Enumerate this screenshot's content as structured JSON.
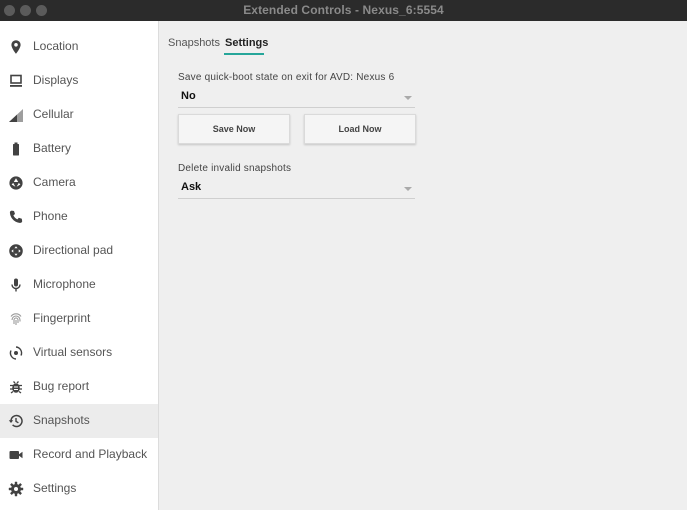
{
  "window": {
    "title": "Extended Controls - Nexus_6:5554"
  },
  "sidebar": {
    "items": [
      {
        "label": "Location",
        "icon": "location-pin-icon"
      },
      {
        "label": "Displays",
        "icon": "display-icon"
      },
      {
        "label": "Cellular",
        "icon": "cellular-signal-icon"
      },
      {
        "label": "Battery",
        "icon": "battery-icon"
      },
      {
        "label": "Camera",
        "icon": "camera-aperture-icon"
      },
      {
        "label": "Phone",
        "icon": "phone-icon"
      },
      {
        "label": "Directional pad",
        "icon": "dpad-icon"
      },
      {
        "label": "Microphone",
        "icon": "microphone-icon"
      },
      {
        "label": "Fingerprint",
        "icon": "fingerprint-icon"
      },
      {
        "label": "Virtual sensors",
        "icon": "rotate-sensor-icon"
      },
      {
        "label": "Bug report",
        "icon": "bug-icon"
      },
      {
        "label": "Snapshots",
        "icon": "history-clock-icon"
      },
      {
        "label": "Record and Playback",
        "icon": "video-camera-icon"
      },
      {
        "label": "Settings",
        "icon": "gear-icon"
      }
    ],
    "active": "Snapshots"
  },
  "tabs": [
    {
      "label": "Snapshots"
    },
    {
      "label": "Settings"
    }
  ],
  "settings": {
    "quickboot_label": "Save quick-boot state on exit for AVD: Nexus 6",
    "quickboot_value": "No",
    "save_now_label": "Save Now",
    "load_now_label": "Load Now",
    "delete_invalid_label": "Delete invalid snapshots",
    "delete_invalid_value": "Ask"
  },
  "colors": {
    "accent": "#26a69a",
    "titlebar": "#2b2b2b"
  }
}
